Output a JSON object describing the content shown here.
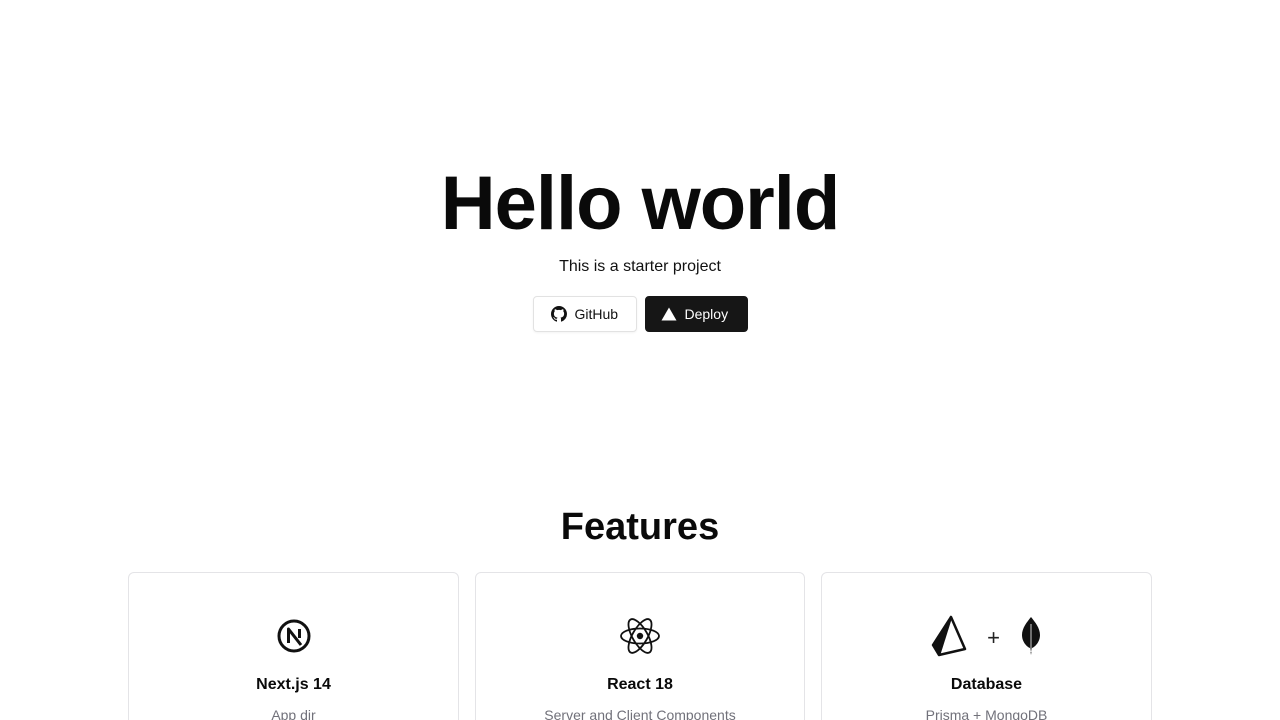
{
  "hero": {
    "title": "Hello world",
    "subtitle": "This is a starter project",
    "buttons": {
      "github_label": "GitHub",
      "github_icon": "github-icon",
      "deploy_label": "Deploy",
      "deploy_icon": "vercel-triangle-icon"
    }
  },
  "features": {
    "title": "Features",
    "cards": [
      {
        "title": "Next.js 14",
        "description": "App dir",
        "icon": "nextjs-icon"
      },
      {
        "title": "React 18",
        "description": "Server and Client Components",
        "icon": "react-icon"
      },
      {
        "title": "Database",
        "description": "Prisma + MongoDB",
        "icons": [
          "prisma-icon",
          "plus-icon",
          "mongodb-icon"
        ],
        "plus_symbol": "+"
      }
    ]
  },
  "colors": {
    "text": "#0a0a0a",
    "muted": "#71717a",
    "border": "#e4e4e7",
    "dark_button": "#161616"
  }
}
